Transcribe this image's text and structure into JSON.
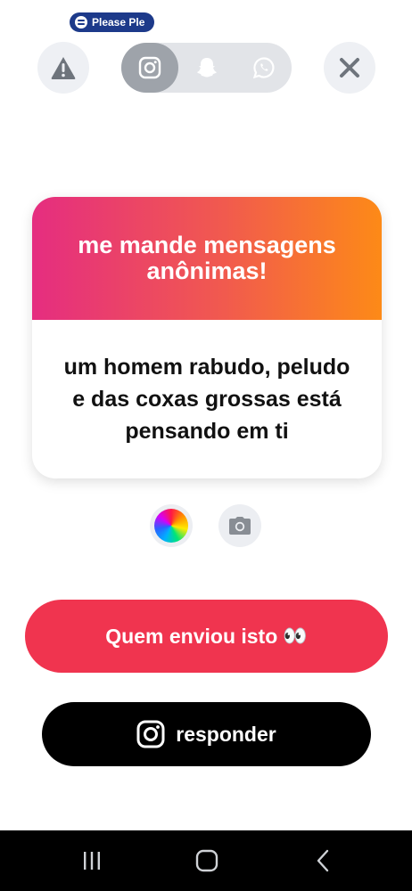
{
  "status": {
    "media_notification": "Please Ple",
    "media_icon": "spotify-icon"
  },
  "top_bar": {
    "report_icon": "warning-icon",
    "share_options": [
      {
        "name": "instagram",
        "icon": "instagram-icon",
        "selected": true
      },
      {
        "name": "snapchat",
        "icon": "snapchat-icon",
        "selected": false
      },
      {
        "name": "whatsapp",
        "icon": "whatsapp-icon",
        "selected": false
      }
    ],
    "close_icon": "close-icon"
  },
  "card": {
    "header": "me mande mensagens anônimas!",
    "message": "um homem rabudo, peludo e das coxas grossas está pensando em ti",
    "gradient": [
      "#e52d80",
      "#fd8a17"
    ]
  },
  "tools": {
    "color_icon": "color-wheel-icon",
    "camera_icon": "camera-icon"
  },
  "actions": {
    "who_sent": "Quem enviou isto",
    "who_sent_emoji": "👀",
    "reply": "responder",
    "who_sent_color": "#f0344f",
    "reply_color": "#000000"
  },
  "system_nav": {
    "recent_icon": "recent-apps-icon",
    "home_icon": "home-icon",
    "back_icon": "back-icon"
  }
}
